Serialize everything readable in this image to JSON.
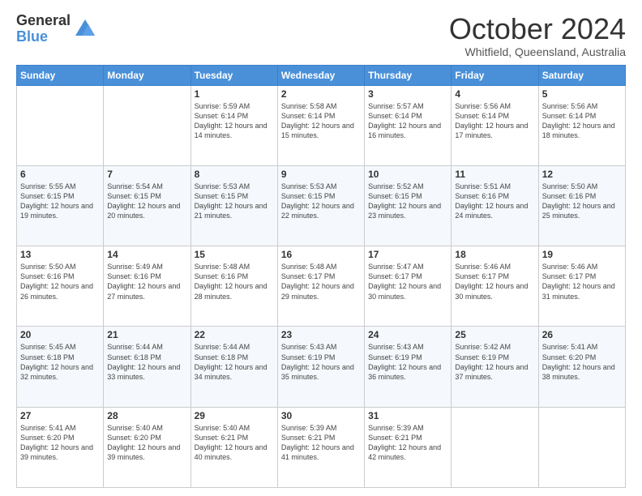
{
  "logo": {
    "general": "General",
    "blue": "Blue"
  },
  "header": {
    "month": "October 2024",
    "location": "Whitfield, Queensland, Australia"
  },
  "weekdays": [
    "Sunday",
    "Monday",
    "Tuesday",
    "Wednesday",
    "Thursday",
    "Friday",
    "Saturday"
  ],
  "weeks": [
    [
      {
        "day": "",
        "sunrise": "",
        "sunset": "",
        "daylight": ""
      },
      {
        "day": "",
        "sunrise": "",
        "sunset": "",
        "daylight": ""
      },
      {
        "day": "1",
        "sunrise": "Sunrise: 5:59 AM",
        "sunset": "Sunset: 6:14 PM",
        "daylight": "Daylight: 12 hours and 14 minutes."
      },
      {
        "day": "2",
        "sunrise": "Sunrise: 5:58 AM",
        "sunset": "Sunset: 6:14 PM",
        "daylight": "Daylight: 12 hours and 15 minutes."
      },
      {
        "day": "3",
        "sunrise": "Sunrise: 5:57 AM",
        "sunset": "Sunset: 6:14 PM",
        "daylight": "Daylight: 12 hours and 16 minutes."
      },
      {
        "day": "4",
        "sunrise": "Sunrise: 5:56 AM",
        "sunset": "Sunset: 6:14 PM",
        "daylight": "Daylight: 12 hours and 17 minutes."
      },
      {
        "day": "5",
        "sunrise": "Sunrise: 5:56 AM",
        "sunset": "Sunset: 6:14 PM",
        "daylight": "Daylight: 12 hours and 18 minutes."
      }
    ],
    [
      {
        "day": "6",
        "sunrise": "Sunrise: 5:55 AM",
        "sunset": "Sunset: 6:15 PM",
        "daylight": "Daylight: 12 hours and 19 minutes."
      },
      {
        "day": "7",
        "sunrise": "Sunrise: 5:54 AM",
        "sunset": "Sunset: 6:15 PM",
        "daylight": "Daylight: 12 hours and 20 minutes."
      },
      {
        "day": "8",
        "sunrise": "Sunrise: 5:53 AM",
        "sunset": "Sunset: 6:15 PM",
        "daylight": "Daylight: 12 hours and 21 minutes."
      },
      {
        "day": "9",
        "sunrise": "Sunrise: 5:53 AM",
        "sunset": "Sunset: 6:15 PM",
        "daylight": "Daylight: 12 hours and 22 minutes."
      },
      {
        "day": "10",
        "sunrise": "Sunrise: 5:52 AM",
        "sunset": "Sunset: 6:15 PM",
        "daylight": "Daylight: 12 hours and 23 minutes."
      },
      {
        "day": "11",
        "sunrise": "Sunrise: 5:51 AM",
        "sunset": "Sunset: 6:16 PM",
        "daylight": "Daylight: 12 hours and 24 minutes."
      },
      {
        "day": "12",
        "sunrise": "Sunrise: 5:50 AM",
        "sunset": "Sunset: 6:16 PM",
        "daylight": "Daylight: 12 hours and 25 minutes."
      }
    ],
    [
      {
        "day": "13",
        "sunrise": "Sunrise: 5:50 AM",
        "sunset": "Sunset: 6:16 PM",
        "daylight": "Daylight: 12 hours and 26 minutes."
      },
      {
        "day": "14",
        "sunrise": "Sunrise: 5:49 AM",
        "sunset": "Sunset: 6:16 PM",
        "daylight": "Daylight: 12 hours and 27 minutes."
      },
      {
        "day": "15",
        "sunrise": "Sunrise: 5:48 AM",
        "sunset": "Sunset: 6:16 PM",
        "daylight": "Daylight: 12 hours and 28 minutes."
      },
      {
        "day": "16",
        "sunrise": "Sunrise: 5:48 AM",
        "sunset": "Sunset: 6:17 PM",
        "daylight": "Daylight: 12 hours and 29 minutes."
      },
      {
        "day": "17",
        "sunrise": "Sunrise: 5:47 AM",
        "sunset": "Sunset: 6:17 PM",
        "daylight": "Daylight: 12 hours and 30 minutes."
      },
      {
        "day": "18",
        "sunrise": "Sunrise: 5:46 AM",
        "sunset": "Sunset: 6:17 PM",
        "daylight": "Daylight: 12 hours and 30 minutes."
      },
      {
        "day": "19",
        "sunrise": "Sunrise: 5:46 AM",
        "sunset": "Sunset: 6:17 PM",
        "daylight": "Daylight: 12 hours and 31 minutes."
      }
    ],
    [
      {
        "day": "20",
        "sunrise": "Sunrise: 5:45 AM",
        "sunset": "Sunset: 6:18 PM",
        "daylight": "Daylight: 12 hours and 32 minutes."
      },
      {
        "day": "21",
        "sunrise": "Sunrise: 5:44 AM",
        "sunset": "Sunset: 6:18 PM",
        "daylight": "Daylight: 12 hours and 33 minutes."
      },
      {
        "day": "22",
        "sunrise": "Sunrise: 5:44 AM",
        "sunset": "Sunset: 6:18 PM",
        "daylight": "Daylight: 12 hours and 34 minutes."
      },
      {
        "day": "23",
        "sunrise": "Sunrise: 5:43 AM",
        "sunset": "Sunset: 6:19 PM",
        "daylight": "Daylight: 12 hours and 35 minutes."
      },
      {
        "day": "24",
        "sunrise": "Sunrise: 5:43 AM",
        "sunset": "Sunset: 6:19 PM",
        "daylight": "Daylight: 12 hours and 36 minutes."
      },
      {
        "day": "25",
        "sunrise": "Sunrise: 5:42 AM",
        "sunset": "Sunset: 6:19 PM",
        "daylight": "Daylight: 12 hours and 37 minutes."
      },
      {
        "day": "26",
        "sunrise": "Sunrise: 5:41 AM",
        "sunset": "Sunset: 6:20 PM",
        "daylight": "Daylight: 12 hours and 38 minutes."
      }
    ],
    [
      {
        "day": "27",
        "sunrise": "Sunrise: 5:41 AM",
        "sunset": "Sunset: 6:20 PM",
        "daylight": "Daylight: 12 hours and 39 minutes."
      },
      {
        "day": "28",
        "sunrise": "Sunrise: 5:40 AM",
        "sunset": "Sunset: 6:20 PM",
        "daylight": "Daylight: 12 hours and 39 minutes."
      },
      {
        "day": "29",
        "sunrise": "Sunrise: 5:40 AM",
        "sunset": "Sunset: 6:21 PM",
        "daylight": "Daylight: 12 hours and 40 minutes."
      },
      {
        "day": "30",
        "sunrise": "Sunrise: 5:39 AM",
        "sunset": "Sunset: 6:21 PM",
        "daylight": "Daylight: 12 hours and 41 minutes."
      },
      {
        "day": "31",
        "sunrise": "Sunrise: 5:39 AM",
        "sunset": "Sunset: 6:21 PM",
        "daylight": "Daylight: 12 hours and 42 minutes."
      },
      {
        "day": "",
        "sunrise": "",
        "sunset": "",
        "daylight": ""
      },
      {
        "day": "",
        "sunrise": "",
        "sunset": "",
        "daylight": ""
      }
    ]
  ]
}
